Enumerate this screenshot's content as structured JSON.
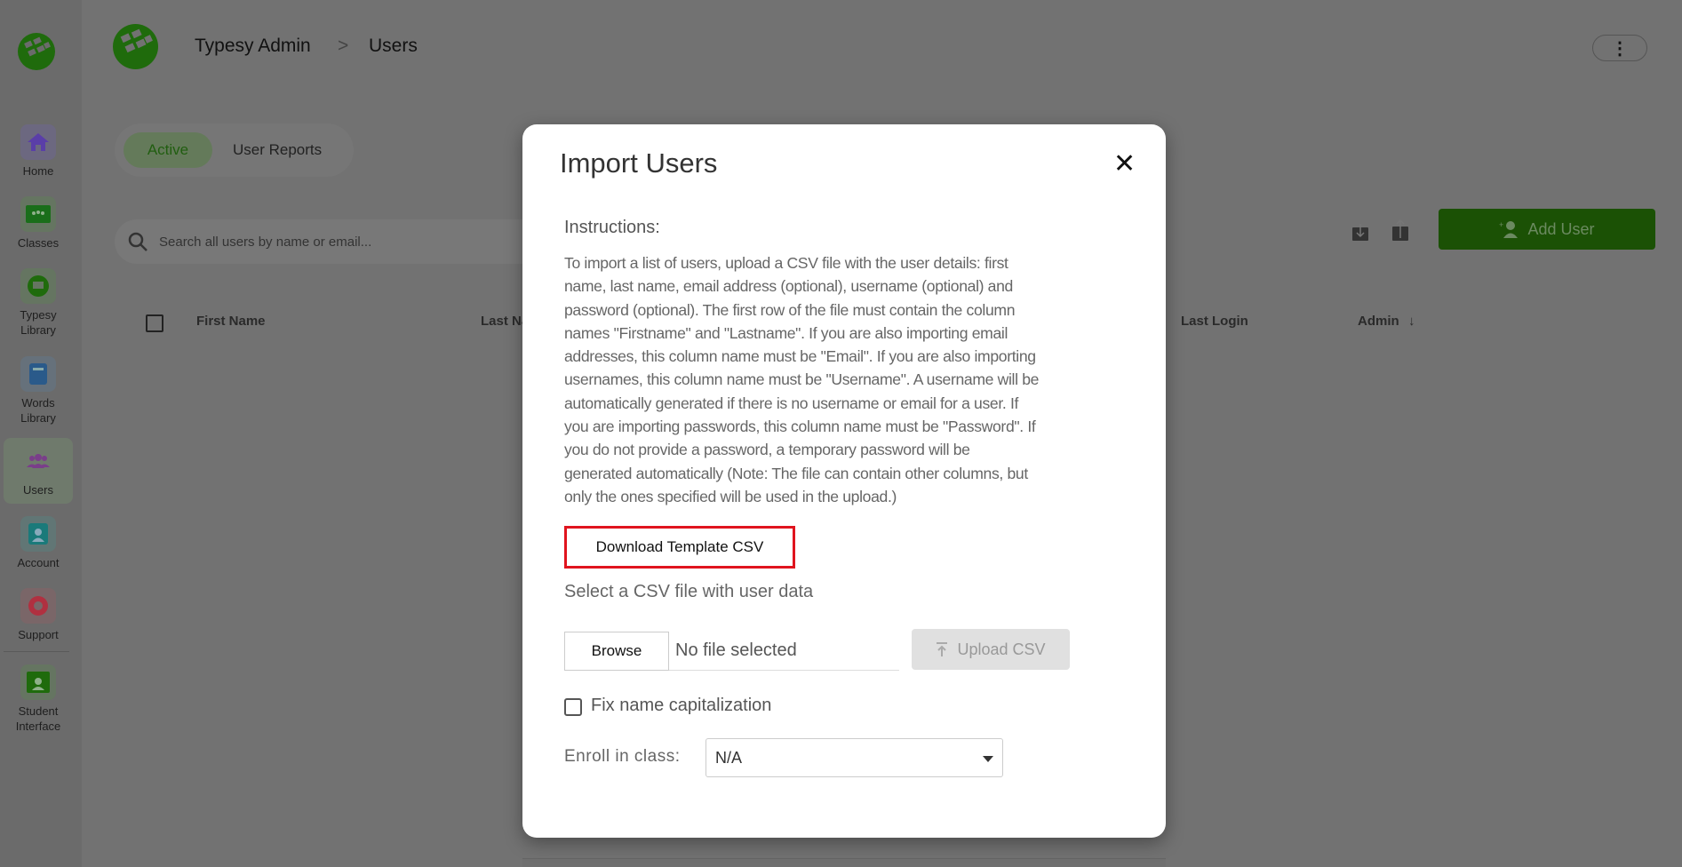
{
  "sidebar": {
    "items": [
      {
        "label": "Home",
        "color": "#5a3ea8",
        "bg": "#6c6880"
      },
      {
        "label": "Classes",
        "color": "#1a6e1a",
        "bg": "#657561"
      },
      {
        "label": "Typesy Library",
        "line1": "Typesy",
        "line2": "Library",
        "color": "#1f6b0c",
        "bg": "#657561"
      },
      {
        "label": "Words Library",
        "line1": "Words",
        "line2": "Library",
        "color": "#2a5a8a",
        "bg": "#66717b"
      },
      {
        "label": "Users",
        "color": "#7a3e8a",
        "bg": "#6f7a6c"
      },
      {
        "label": "Account",
        "color": "#1a7a7a",
        "bg": "#617675"
      },
      {
        "label": "Support",
        "color": "#b03040",
        "bg": "#7a6668"
      },
      {
        "label": "Student Interface",
        "line1": "Student",
        "line2": "Interface",
        "color": "#1f6b0c",
        "bg": "#657561"
      }
    ]
  },
  "header": {
    "title": "Typesy Admin",
    "separator": ">",
    "current": "Users",
    "menu_icon": "⋮"
  },
  "tabs": {
    "active": "Active",
    "reports": "User Reports"
  },
  "search": {
    "placeholder": "Search all users by name or email..."
  },
  "actions": {
    "add_user": "Add User"
  },
  "table": {
    "columns": [
      "First Name",
      "Last Name",
      "Last Login",
      "Admin"
    ]
  },
  "modal": {
    "title": "Import Users",
    "close": "✕",
    "instructions_heading": "Instructions:",
    "instructions_lines": [
      "To import a list of users, upload a CSV file with the user details: first",
      "name, last name, email address (optional), username (optional) and",
      "password (optional). The first row of the file must contain the column",
      "names \"Firstname\" and \"Lastname\". If you are also importing email",
      "addresses, this column name must be \"Email\". If you are also importing",
      "usernames, this column name must be \"Username\". A username will be",
      "automatically generated if there is no username or email for a user. If",
      "you are importing passwords, this column name must be \"Password\". If",
      "you do not provide a password, a temporary password will be",
      "generated automatically (Note: The file can contain other columns, but",
      "only the ones specified will be used in the upload.)"
    ],
    "download_template": "Download Template CSV",
    "select_label": "Select a CSV file with user data",
    "browse": "Browse",
    "file_status": "No file selected",
    "upload": "Upload CSV",
    "fix_caps_label": "Fix name capitalization",
    "fix_caps_checked": false,
    "enroll_label": "Enroll in class:",
    "enroll_value": "N/A"
  }
}
